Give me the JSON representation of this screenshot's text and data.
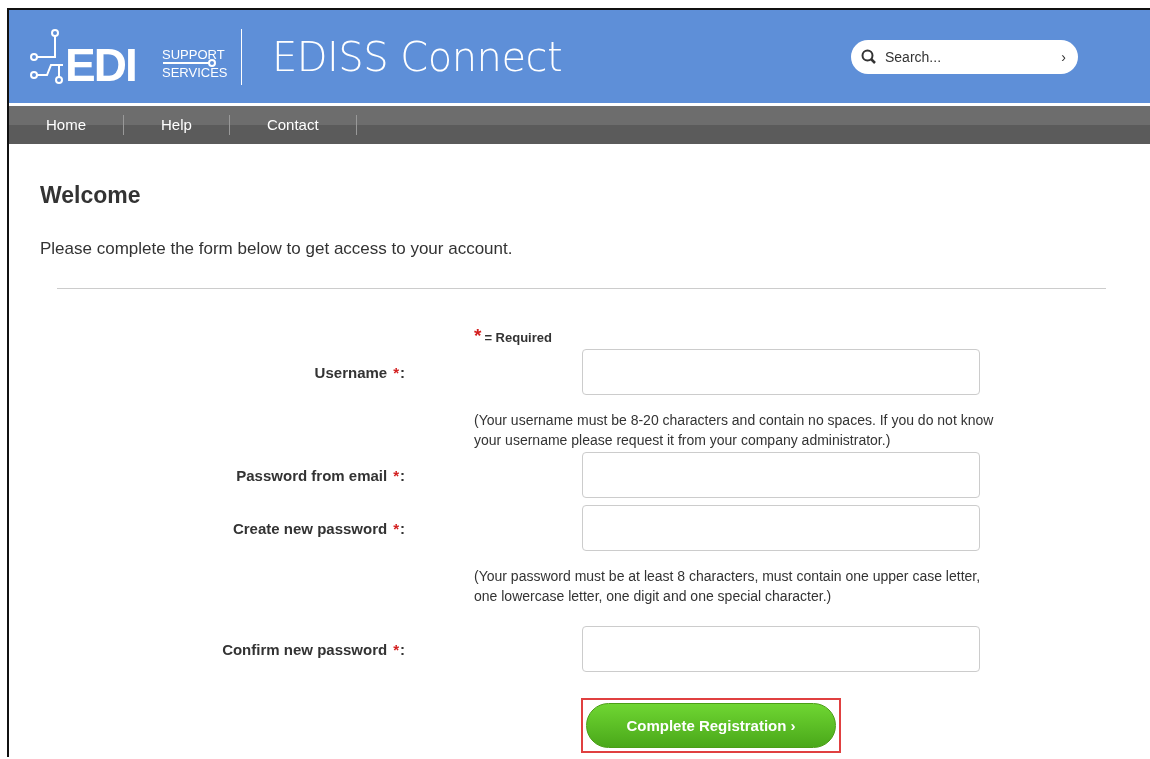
{
  "header": {
    "logo": {
      "big": "EDI",
      "top": "SUPPORT",
      "bottom": "SERVICES"
    },
    "title": "EDISS Connect",
    "search": {
      "placeholder": "Search...",
      "go": "›"
    }
  },
  "nav": [
    {
      "label": "Home"
    },
    {
      "label": "Help"
    },
    {
      "label": "Contact"
    }
  ],
  "heading": "Welcome",
  "intro": "Please complete the form below to get access to your account.",
  "required_legend": {
    "mark": "*",
    "text": "= Required"
  },
  "rows": [
    {
      "kind": "field",
      "label": "Username",
      "mark": "*",
      "suffix": ":"
    },
    {
      "kind": "hint",
      "text": "(Your username must be 8-20 characters and contain no spaces. If you do not know your username please request it from your company administrator.)"
    },
    {
      "kind": "field",
      "label": "Password from email",
      "mark": "*",
      "suffix": ":"
    },
    {
      "kind": "field",
      "label": "Create new password",
      "mark": "*",
      "suffix": ":"
    },
    {
      "kind": "hint",
      "text": "(Your password must be at least 8 characters, must contain one upper case letter, one lowercase letter, one digit and one special character.)"
    },
    {
      "kind": "field",
      "label": "Confirm new password",
      "mark": "*",
      "suffix": ":"
    }
  ],
  "submit": {
    "label": "Complete Registration ›",
    "highlighted": true
  }
}
